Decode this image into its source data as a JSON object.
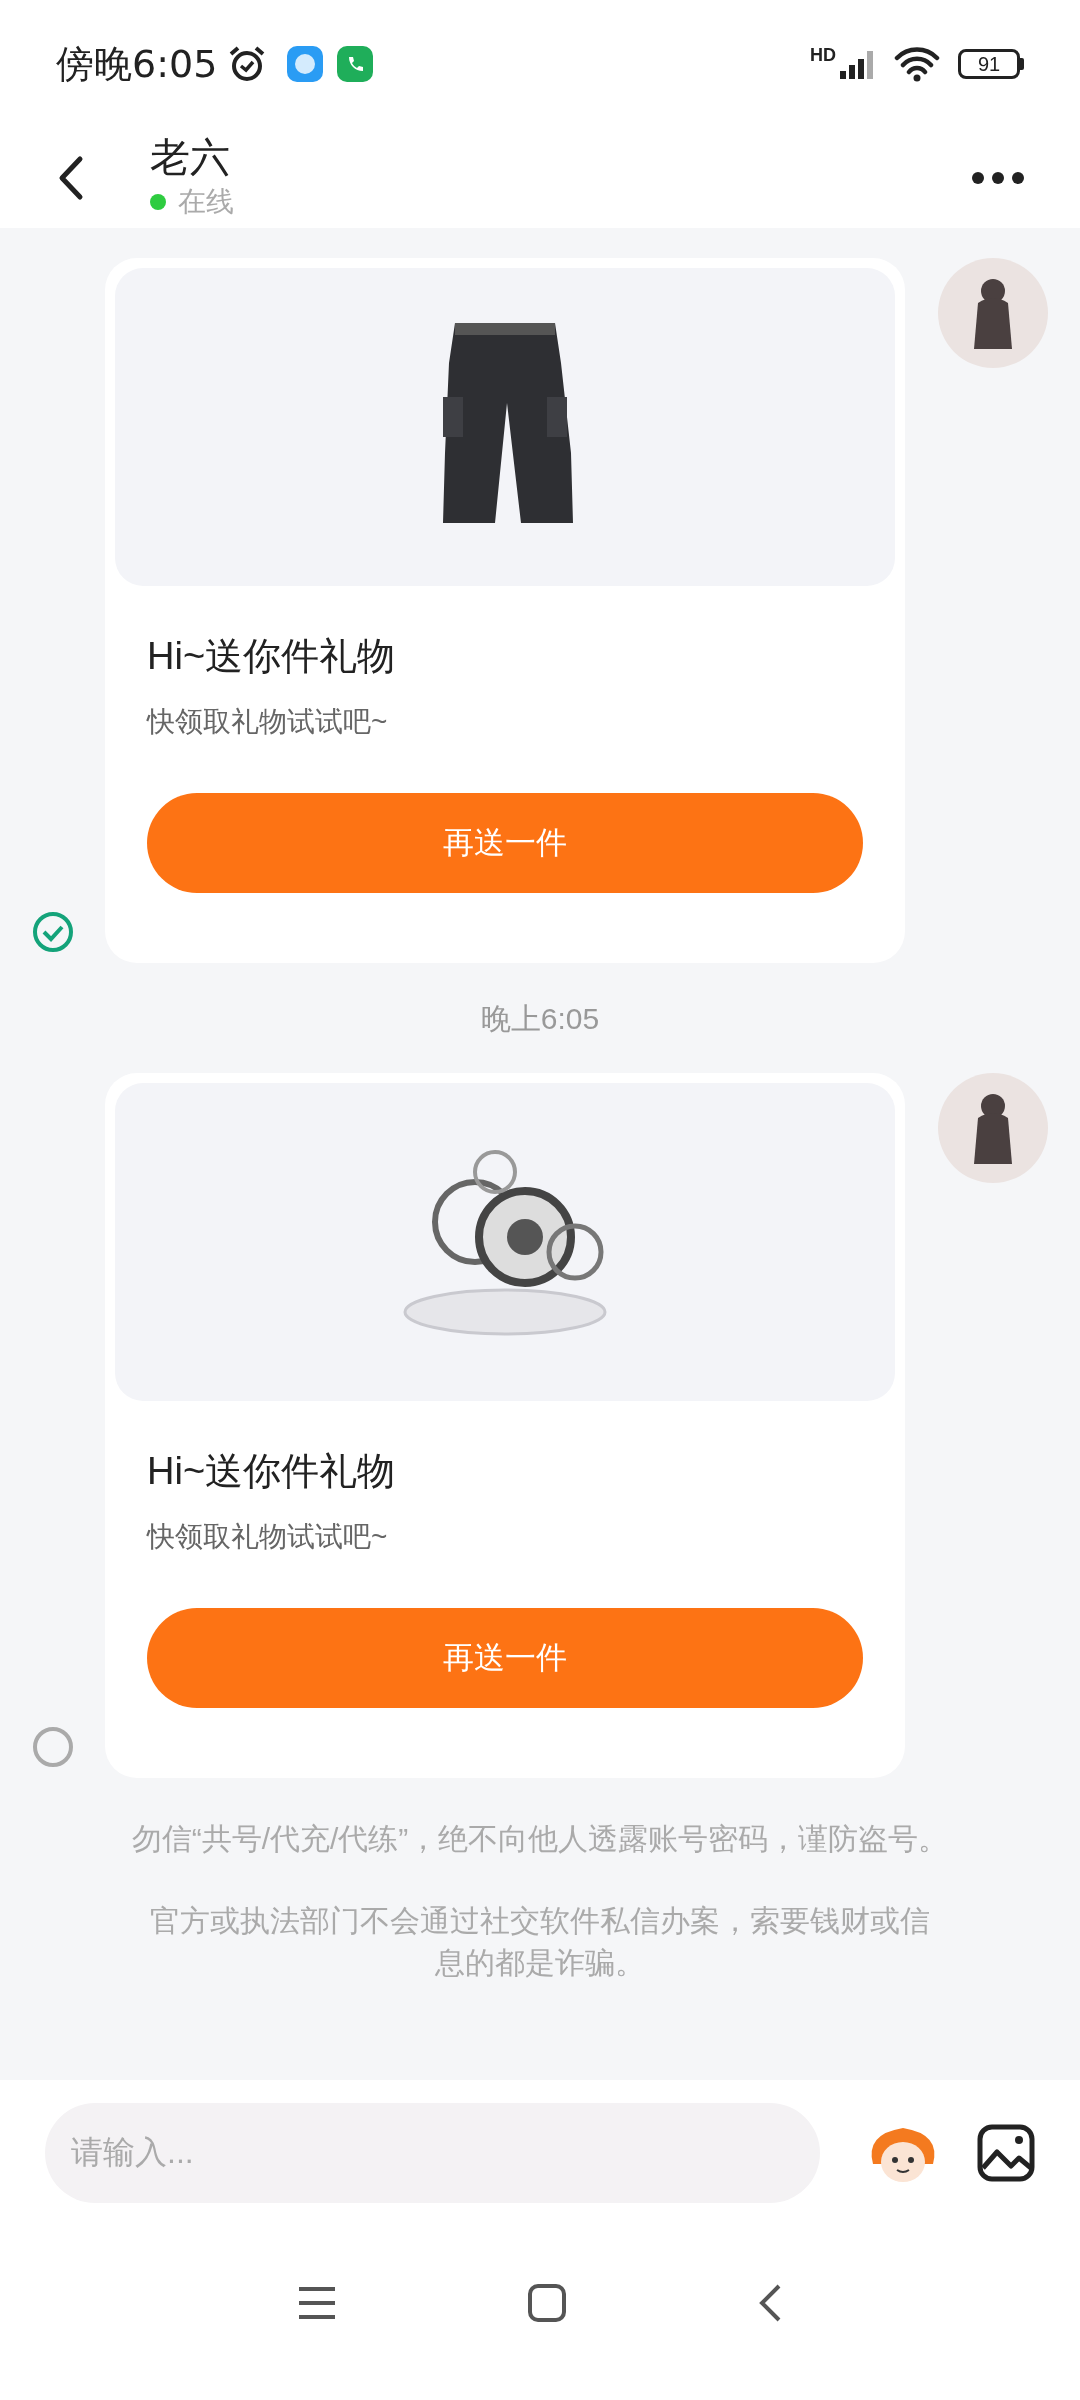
{
  "status_bar": {
    "time": "傍晚6:05",
    "network": "HD",
    "battery": "91"
  },
  "header": {
    "title": "老六",
    "presence": "在线",
    "online": true
  },
  "messages": [
    {
      "kind": "gift",
      "product": {
        "kind": "pants"
      },
      "title": "Hi~送你件礼物",
      "subtitle": "快领取礼物试试吧~",
      "button": "再送一件",
      "read": true
    },
    {
      "kind": "time",
      "text": "晚上6:05"
    },
    {
      "kind": "gift",
      "product": {
        "kind": "orbs"
      },
      "title": "Hi~送你件礼物",
      "subtitle": "快领取礼物试试吧~",
      "button": "再送一件",
      "read": false
    }
  ],
  "notices": [
    "勿信“共号/代充/代练”，绝不向他人透露账号密码，谨防盗号。",
    "官方或执法部门不会通过社交软件私信办案，索要钱财或信息的都是诈骗。"
  ],
  "input": {
    "placeholder": "请输入..."
  }
}
